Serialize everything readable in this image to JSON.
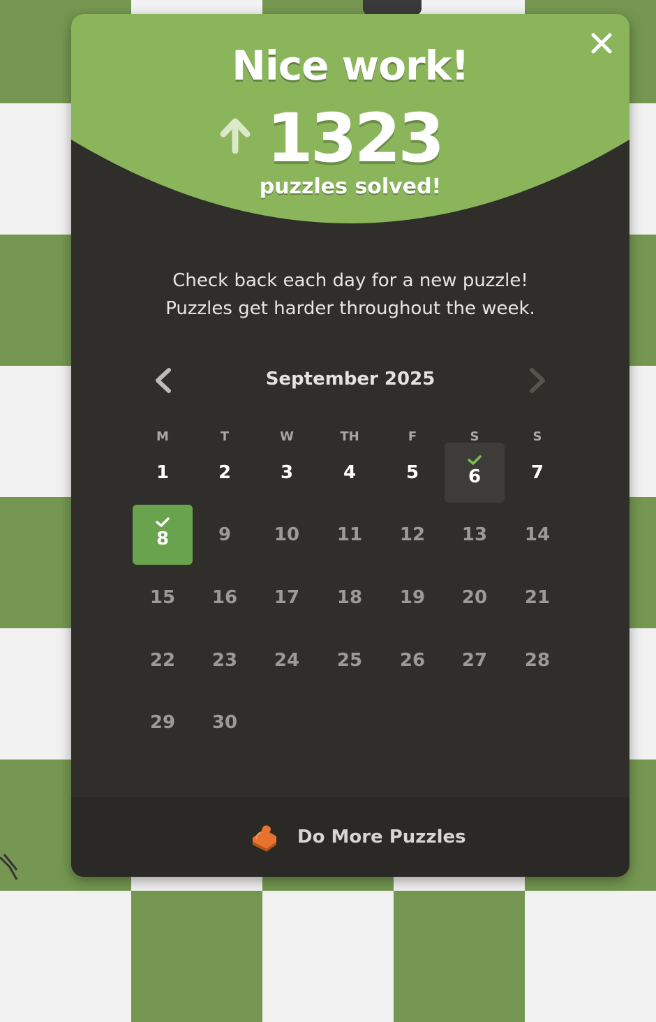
{
  "colors": {
    "accent_green": "#8bb55b",
    "modal_bg": "#2f2e2b",
    "today_green": "#69a34d",
    "board_dark": "#759751",
    "board_light": "#f2f2f2"
  },
  "header": {
    "title": "Nice work!",
    "count": "1323",
    "count_label": "puzzles solved!",
    "close_icon": "close-icon",
    "arrow_icon": "arrow-up-icon"
  },
  "message": {
    "line1": "Check back each day for a new puzzle!",
    "line2": "Puzzles get harder throughout the week."
  },
  "calendar": {
    "month": "September 2025",
    "prev_icon": "chevron-left-icon",
    "next_icon": "chevron-right-icon",
    "weekdays": [
      "M",
      "T",
      "W",
      "TH",
      "F",
      "S",
      "S"
    ],
    "days": [
      "1",
      "2",
      "3",
      "4",
      "5",
      "6",
      "7",
      "8",
      "9",
      "10",
      "11",
      "12",
      "13",
      "14",
      "15",
      "16",
      "17",
      "18",
      "19",
      "20",
      "21",
      "22",
      "23",
      "24",
      "25",
      "26",
      "27",
      "28",
      "29",
      "30"
    ],
    "solved_days": [
      "6",
      "8"
    ],
    "today": "8"
  },
  "footer": {
    "label": "Do More Puzzles",
    "icon": "puzzle-piece-icon"
  }
}
